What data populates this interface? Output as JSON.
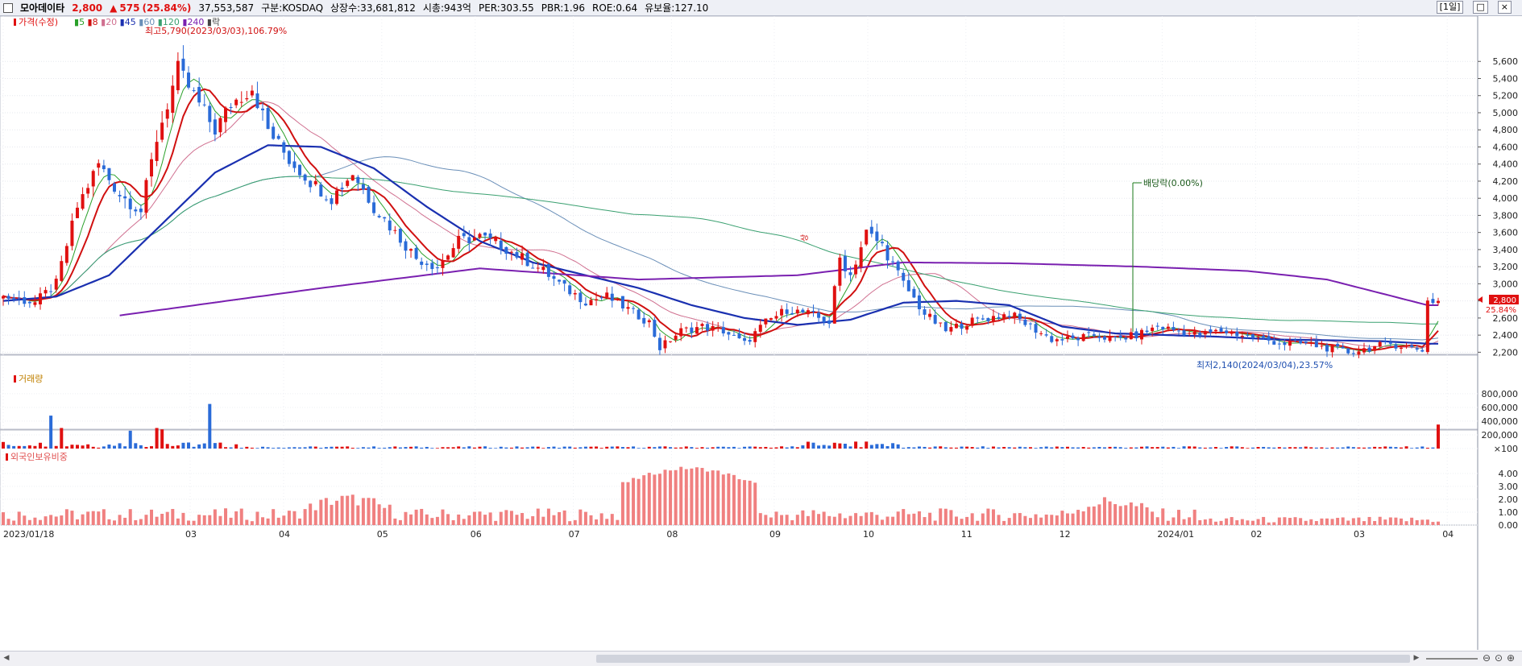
{
  "header": {
    "stock_name": "모아데이타",
    "price": "2,800",
    "change_arrow": "▲",
    "change": "575",
    "change_pct": "(25.84%)",
    "volume": "37,553,587",
    "market": "구분:KOSDAQ",
    "listed_shares": "상장수:33,681,812",
    "market_cap": "시총:943억",
    "per": "PER:303.55",
    "pbr": "PBR:1.96",
    "roe": "ROE:0.64",
    "float": "유보율:127.10",
    "period_button": "[1일]",
    "restore_button": "□",
    "close_button": "×"
  },
  "legend": {
    "price_label": "가격(수정)",
    "ma_labels": [
      "5",
      "8",
      "20",
      "45",
      "60",
      "120",
      "240"
    ],
    "ex_label": "락"
  },
  "colors": {
    "up": "#e01010",
    "down": "#2a6bd8",
    "ma5": "#2aa02a",
    "ma8": "#d01010",
    "ma20": "#d07090",
    "ma45": "#1a30b0",
    "ma60": "#6a8fb8",
    "ma120": "#3aa070",
    "ma240": "#7a20b0",
    "foreign": "#f08080",
    "dividend": "#1a7a1a"
  },
  "annotations": {
    "high": "최고5,790(2023/03/03),106.79%",
    "low": "최저2,140(2024/03/04),23.57%",
    "dividend": "배당락(0.00%)",
    "limit_up": "상",
    "current_price": "2,800",
    "current_pct": "25.84%"
  },
  "panels": {
    "volume_title": "거래량",
    "foreign_title": "외국인보유비중"
  },
  "axes": {
    "x_labels": [
      "2023/01/18",
      "03",
      "04",
      "05",
      "06",
      "07",
      "08",
      "09",
      "10",
      "11",
      "12",
      "2024/01",
      "02",
      "03",
      "04"
    ],
    "price_ticks": [
      "5,600",
      "5,400",
      "5,200",
      "5,000",
      "4,800",
      "4,600",
      "4,400",
      "4,200",
      "4,000",
      "3,800",
      "3,600",
      "3,400",
      "3,200",
      "3,000",
      "2,800",
      "2,600",
      "2,400",
      "2,200"
    ],
    "volume_ticks": [
      "800,000",
      "600,000",
      "400,000",
      "200,000",
      "×100"
    ],
    "foreign_ticks": [
      "4.00",
      "3.00",
      "2.00",
      "1.00",
      "0.00"
    ]
  },
  "chart_data": {
    "type": "candlestick",
    "x_start": "2023/01/18",
    "x_end": "2024/04/02",
    "price_range": [
      2100,
      5800
    ],
    "volume_range": [
      0,
      880000
    ],
    "foreign_range": [
      0,
      4.8
    ],
    "price_keypoints": [
      [
        0,
        2850
      ],
      [
        6,
        2780
      ],
      [
        10,
        3000
      ],
      [
        14,
        3900
      ],
      [
        18,
        4400
      ],
      [
        22,
        4050
      ],
      [
        26,
        3850
      ],
      [
        29,
        4700
      ],
      [
        33,
        5500
      ],
      [
        36,
        5200
      ],
      [
        40,
        4800
      ],
      [
        43,
        5100
      ],
      [
        47,
        5300
      ],
      [
        50,
        4800
      ],
      [
        54,
        4450
      ],
      [
        58,
        4200
      ],
      [
        62,
        4000
      ],
      [
        66,
        4300
      ],
      [
        70,
        3900
      ],
      [
        74,
        3600
      ],
      [
        78,
        3300
      ],
      [
        82,
        3200
      ],
      [
        86,
        3500
      ],
      [
        90,
        3550
      ],
      [
        94,
        3450
      ],
      [
        98,
        3300
      ],
      [
        102,
        3150
      ],
      [
        106,
        2950
      ],
      [
        110,
        2800
      ],
      [
        114,
        2850
      ],
      [
        118,
        2700
      ],
      [
        122,
        2550
      ],
      [
        124,
        2250
      ],
      [
        128,
        2450
      ],
      [
        132,
        2500
      ],
      [
        136,
        2450
      ],
      [
        140,
        2300
      ],
      [
        144,
        2550
      ],
      [
        148,
        2700
      ],
      [
        152,
        2650
      ],
      [
        156,
        2550
      ],
      [
        158,
        3300
      ],
      [
        160,
        3100
      ],
      [
        163,
        3600
      ],
      [
        166,
        3450
      ],
      [
        170,
        3000
      ],
      [
        174,
        2650
      ],
      [
        178,
        2450
      ],
      [
        182,
        2550
      ],
      [
        186,
        2600
      ],
      [
        190,
        2650
      ],
      [
        194,
        2500
      ],
      [
        198,
        2350
      ],
      [
        202,
        2350
      ],
      [
        206,
        2400
      ],
      [
        210,
        2350
      ],
      [
        214,
        2400
      ],
      [
        218,
        2500
      ],
      [
        222,
        2450
      ],
      [
        226,
        2400
      ],
      [
        230,
        2450
      ],
      [
        234,
        2400
      ],
      [
        238,
        2350
      ],
      [
        242,
        2300
      ],
      [
        246,
        2300
      ],
      [
        250,
        2250
      ],
      [
        254,
        2200
      ],
      [
        258,
        2250
      ],
      [
        262,
        2300
      ],
      [
        266,
        2250
      ],
      [
        268,
        2230
      ],
      [
        269,
        2800
      ]
    ],
    "ma45": [
      [
        0,
        2800
      ],
      [
        10,
        2850
      ],
      [
        20,
        3100
      ],
      [
        30,
        3700
      ],
      [
        40,
        4300
      ],
      [
        50,
        4620
      ],
      [
        60,
        4600
      ],
      [
        70,
        4350
      ],
      [
        80,
        3900
      ],
      [
        90,
        3500
      ],
      [
        100,
        3250
      ],
      [
        110,
        3100
      ],
      [
        120,
        2950
      ],
      [
        130,
        2750
      ],
      [
        140,
        2600
      ],
      [
        150,
        2520
      ],
      [
        160,
        2580
      ],
      [
        170,
        2780
      ],
      [
        180,
        2800
      ],
      [
        190,
        2750
      ],
      [
        200,
        2500
      ],
      [
        210,
        2420
      ],
      [
        220,
        2400
      ],
      [
        230,
        2380
      ],
      [
        240,
        2350
      ],
      [
        250,
        2340
      ],
      [
        260,
        2330
      ],
      [
        269,
        2300
      ]
    ],
    "ma240": [
      [
        22,
        2630
      ],
      [
        60,
        2950
      ],
      [
        90,
        3180
      ],
      [
        120,
        3050
      ],
      [
        150,
        3100
      ],
      [
        170,
        3250
      ],
      [
        190,
        3240
      ],
      [
        215,
        3200
      ],
      [
        235,
        3150
      ],
      [
        250,
        3050
      ],
      [
        269,
        2750
      ]
    ],
    "volume_spikes": [
      [
        9,
        480000
      ],
      [
        11,
        300000
      ],
      [
        24,
        260000
      ],
      [
        29,
        300000
      ],
      [
        30,
        280000
      ],
      [
        39,
        650000
      ],
      [
        271,
        350000
      ]
    ],
    "foreign_peak": {
      "from": 117,
      "to": 142,
      "max": 4.4
    }
  }
}
